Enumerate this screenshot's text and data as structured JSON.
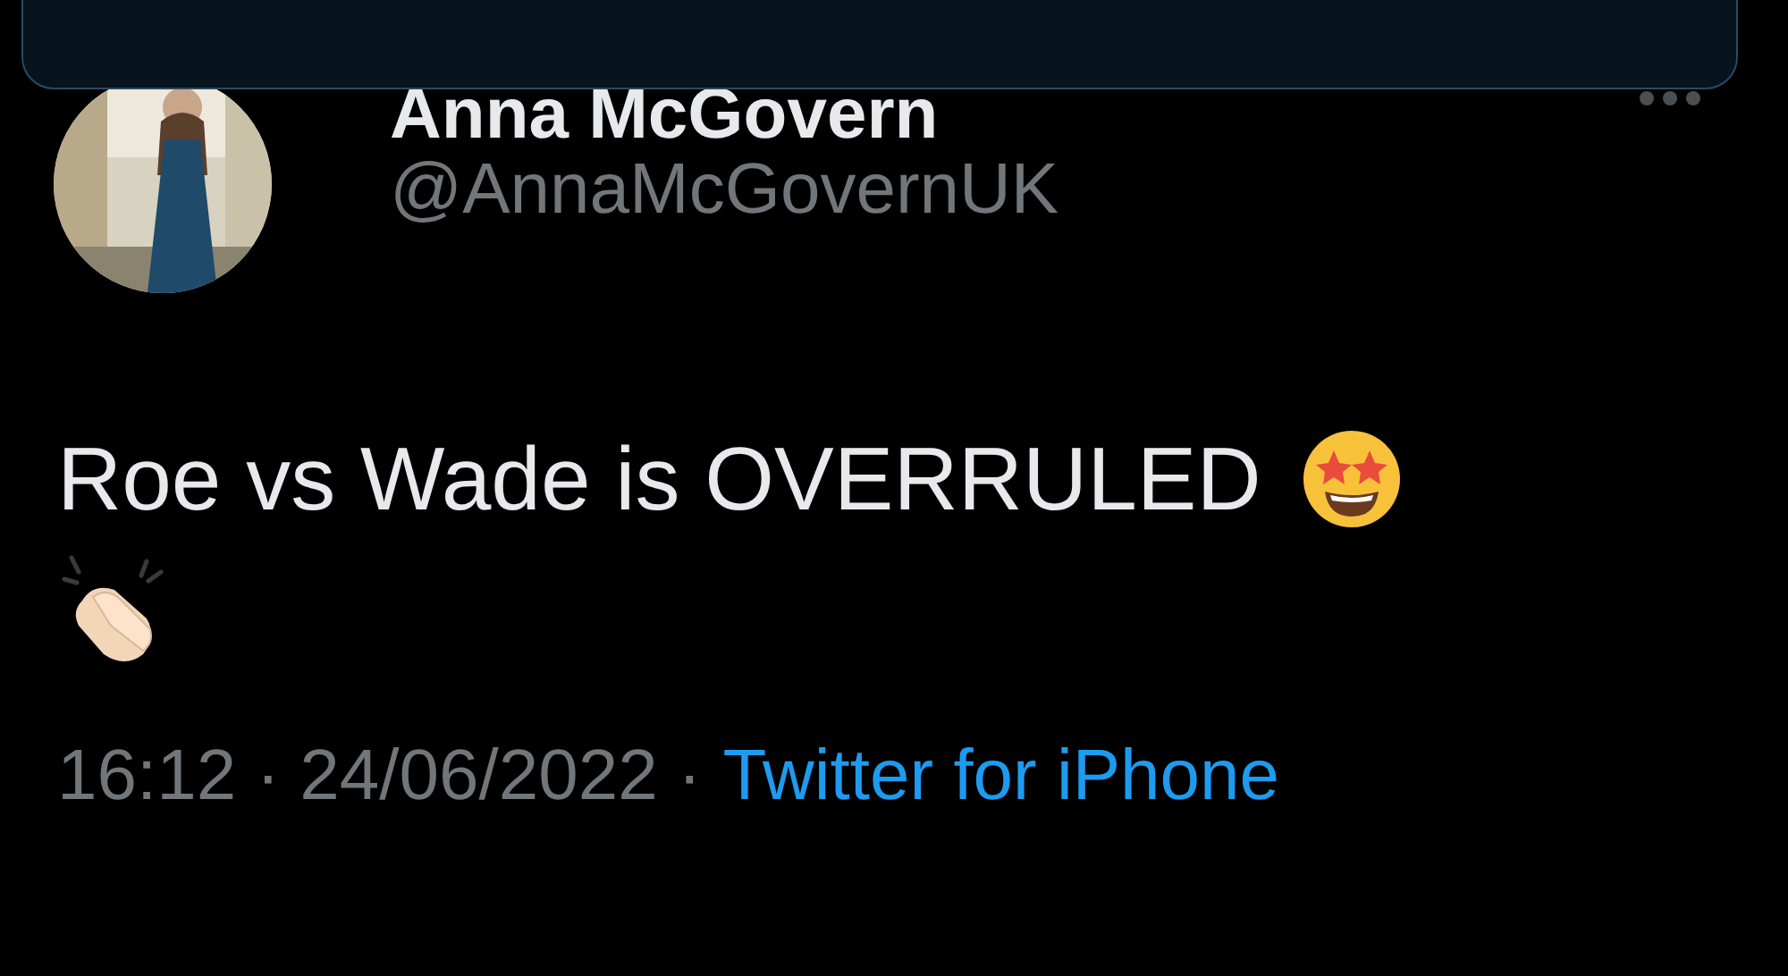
{
  "tweet": {
    "author": {
      "name": "Anna McGovern",
      "handle": "@AnnaMcGovernUK"
    },
    "text": "Roe vs Wade is OVERRULED",
    "timestamp": "16:12 · 24/06/2022 ·",
    "source": "Twitter for iPhone"
  }
}
